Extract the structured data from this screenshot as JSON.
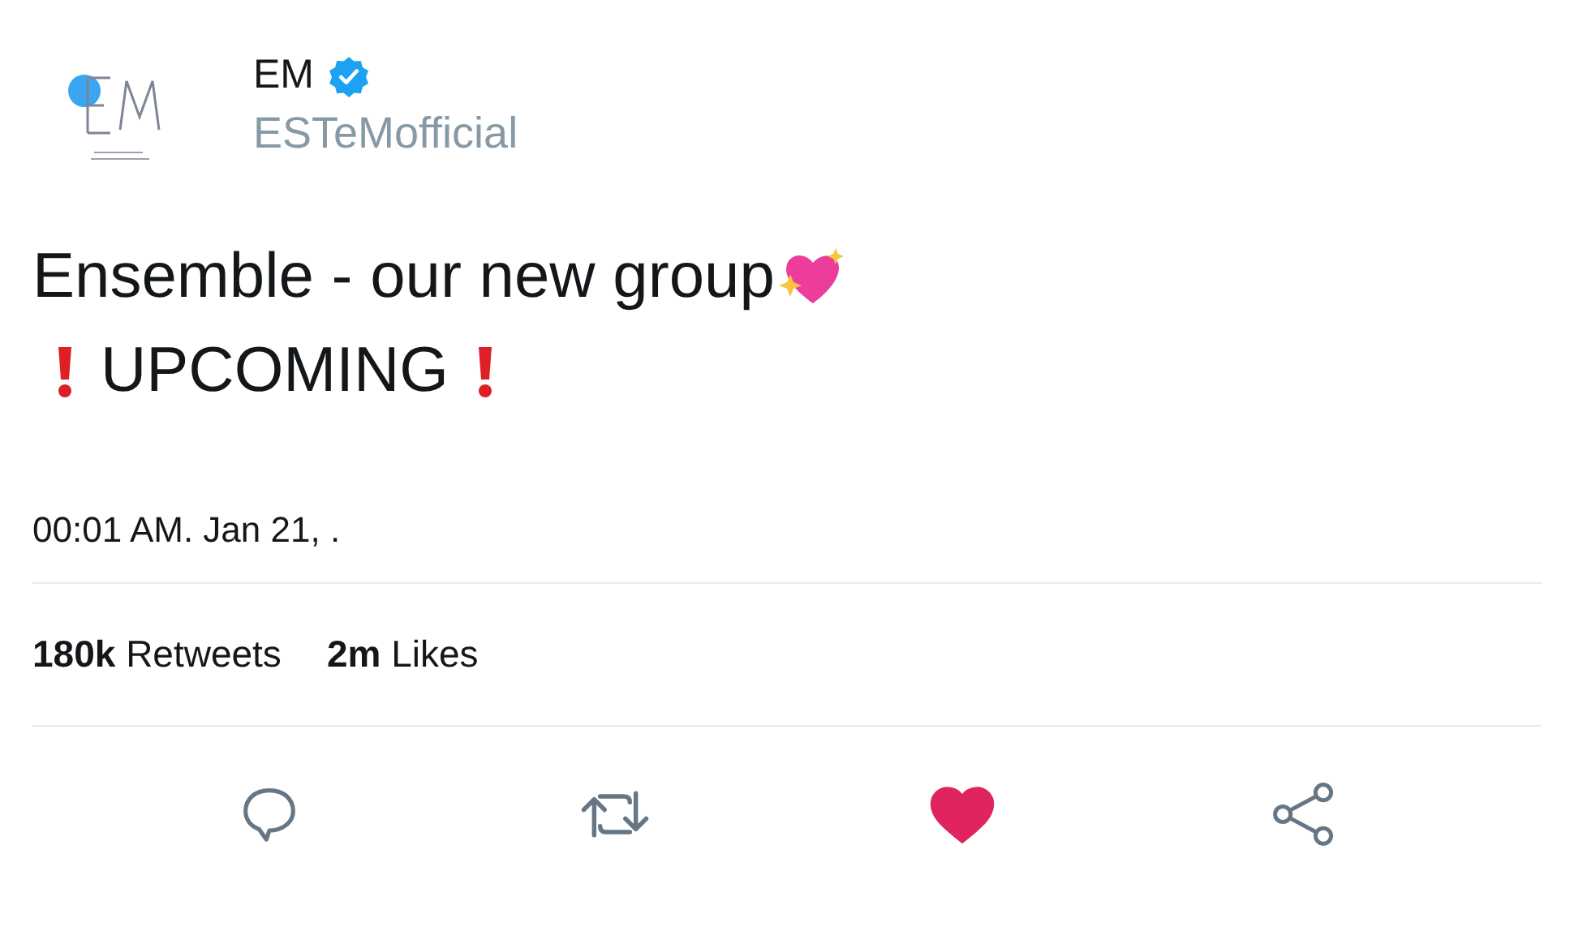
{
  "author": {
    "name": "EM",
    "verified": true,
    "handle": "ESTeMofficial"
  },
  "text_lines": [
    "Ensemble - our new group",
    "UPCOMING"
  ],
  "timestamp": "00:01 AM. Jan 21, .",
  "stats": [
    {
      "count": "180k",
      "label": "Retweets"
    },
    {
      "count": "2m",
      "label": "Likes"
    }
  ],
  "actions": {
    "liked": true
  }
}
